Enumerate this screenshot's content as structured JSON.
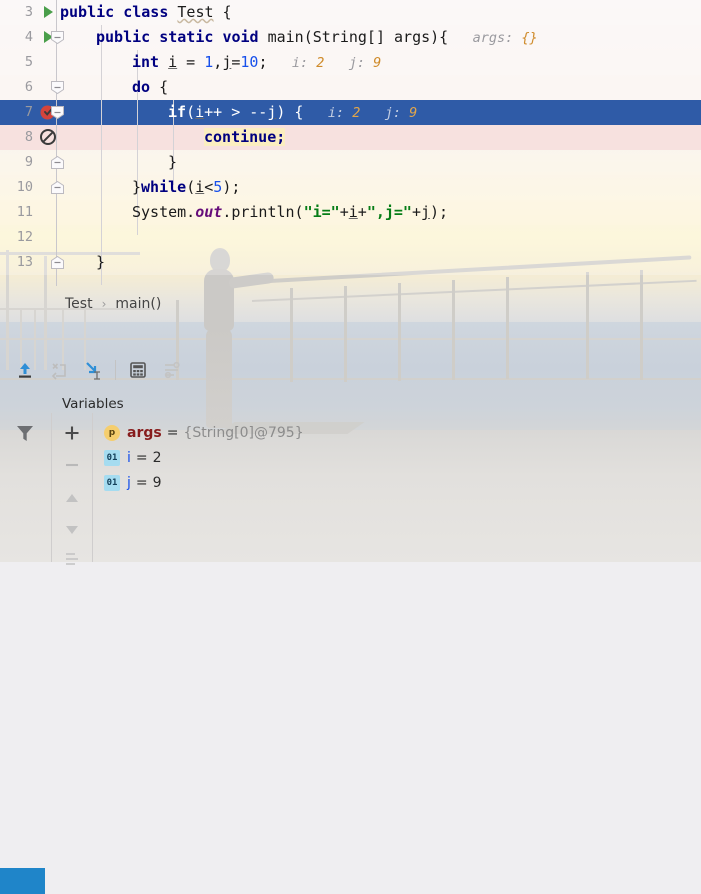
{
  "editor": {
    "lines": [
      {
        "num": "3",
        "indent": 0,
        "gutter_icon": "run-gutter-icon",
        "fold": null,
        "tokens": [
          {
            "t": "public",
            "c": "kw"
          },
          {
            "t": " ",
            "c": ""
          },
          {
            "t": "class",
            "c": "kw"
          },
          {
            "t": " ",
            "c": ""
          },
          {
            "t": "Test",
            "c": "warn"
          },
          {
            "t": " {",
            "c": ""
          }
        ]
      },
      {
        "num": "4",
        "indent": 1,
        "gutter_icon": "run-gutter-icon",
        "fold": "collapse",
        "tokens": [
          {
            "t": "public",
            "c": "kw"
          },
          {
            "t": " ",
            "c": ""
          },
          {
            "t": "static",
            "c": "kw"
          },
          {
            "t": " ",
            "c": ""
          },
          {
            "t": "void",
            "c": "kw"
          },
          {
            "t": " main(String[] args){",
            "c": ""
          }
        ],
        "hint": "args:",
        "hint_value": "{}"
      },
      {
        "num": "5",
        "indent": 2,
        "gutter_icon": null,
        "fold": null,
        "tokens": [
          {
            "t": "int",
            "c": "kw"
          },
          {
            "t": " ",
            "c": ""
          },
          {
            "t": "i",
            "c": "var"
          },
          {
            "t": " = ",
            "c": ""
          },
          {
            "t": "1",
            "c": "num"
          },
          {
            "t": ",",
            "c": ""
          },
          {
            "t": "j",
            "c": "var"
          },
          {
            "t": "=",
            "c": ""
          },
          {
            "t": "10",
            "c": "num"
          },
          {
            "t": ";",
            "c": ""
          }
        ],
        "hint": "i:",
        "hint_value": "2",
        "hint2": "j:",
        "hint2_value": "9"
      },
      {
        "num": "6",
        "indent": 2,
        "gutter_icon": null,
        "fold": "collapse",
        "tokens": [
          {
            "t": "do",
            "c": "kw"
          },
          {
            "t": " {",
            "c": ""
          }
        ]
      },
      {
        "num": "7",
        "indent": 3,
        "gutter_icon": "breakpoint-verified-icon",
        "fold": "collapse",
        "selected": true,
        "tokens": [
          {
            "t": "if",
            "c": "kw"
          },
          {
            "t": "(",
            "c": ""
          },
          {
            "t": "i",
            "c": "var"
          },
          {
            "t": "++ > --",
            "c": ""
          },
          {
            "t": "j",
            "c": "var"
          },
          {
            "t": ") {",
            "c": ""
          }
        ],
        "hint": "i:",
        "hint_value": "2",
        "hint2": "j:",
        "hint2_value": "9"
      },
      {
        "num": "8",
        "indent": 4,
        "gutter_icon": "breakpoint-muted-icon",
        "fold": null,
        "exec_line": true,
        "tokens": [
          {
            "t": "continue;",
            "c": "kw yellowhl"
          }
        ]
      },
      {
        "num": "9",
        "indent": 3,
        "gutter_icon": null,
        "fold": "expand",
        "tokens": [
          {
            "t": "}",
            "c": ""
          }
        ]
      },
      {
        "num": "10",
        "indent": 2,
        "gutter_icon": null,
        "fold": "expand",
        "tokens": [
          {
            "t": "}",
            "c": ""
          },
          {
            "t": "while",
            "c": "kw"
          },
          {
            "t": "(",
            "c": ""
          },
          {
            "t": "i",
            "c": "var"
          },
          {
            "t": "<",
            "c": ""
          },
          {
            "t": "5",
            "c": "num"
          },
          {
            "t": ");",
            "c": ""
          }
        ]
      },
      {
        "num": "11",
        "indent": 2,
        "gutter_icon": null,
        "fold": null,
        "tokens": [
          {
            "t": "System.",
            "c": ""
          },
          {
            "t": "out",
            "c": "fld"
          },
          {
            "t": ".println(",
            "c": ""
          },
          {
            "t": "\"i=\"",
            "c": "str"
          },
          {
            "t": "+",
            "c": ""
          },
          {
            "t": "i",
            "c": "var"
          },
          {
            "t": "+",
            "c": ""
          },
          {
            "t": "\",j=\"",
            "c": "str"
          },
          {
            "t": "+",
            "c": ""
          },
          {
            "t": "j",
            "c": "var"
          },
          {
            "t": ");",
            "c": ""
          }
        ]
      },
      {
        "num": "12",
        "indent": 0,
        "gutter_icon": null,
        "fold": null,
        "tokens": []
      },
      {
        "num": "13",
        "indent": 1,
        "gutter_icon": null,
        "fold": "expand",
        "tokens": [
          {
            "t": "}",
            "c": ""
          }
        ]
      }
    ],
    "colors": {
      "selected_line_bg": "#2f5ba7",
      "execution_line_bg": "#f7e1df",
      "keyword": "#000080",
      "string": "#067d17",
      "number": "#1750eb",
      "field": "#660e7a",
      "inline_hint": "#9a9a9f",
      "inline_hint_value": "#cf8b2b",
      "breakpoint": "#d4443c",
      "accent_blue": "#1f85c9"
    }
  },
  "breadcrumb": {
    "items": [
      "Test",
      "main()"
    ],
    "separator": "›"
  },
  "debug_toolbar": {
    "buttons": [
      {
        "name": "step-out-button",
        "label": "Step Out",
        "enabled": true
      },
      {
        "name": "force-step-into-button",
        "label": "Force Step Into",
        "enabled": false
      },
      {
        "name": "run-to-cursor-button",
        "label": "Run to Cursor",
        "enabled": true
      },
      {
        "name": "evaluate-expression-button",
        "label": "Evaluate Expression",
        "enabled": true
      },
      {
        "name": "settings-button",
        "label": "Settings",
        "enabled": false
      }
    ]
  },
  "variables_panel": {
    "title": "Variables",
    "toolbar": [
      {
        "name": "filter-icon",
        "label": "Filter"
      },
      {
        "name": "add-watch-button",
        "label": "+"
      },
      {
        "name": "remove-watch-button",
        "label": "−"
      },
      {
        "name": "move-up-button",
        "label": "▲"
      },
      {
        "name": "move-down-button",
        "label": "▼"
      }
    ],
    "rows": [
      {
        "icon": "p",
        "icon_kind": "parameter",
        "name": "args",
        "eq": "=",
        "value": "{String[0]@795}",
        "value_dim": true
      },
      {
        "icon": "01",
        "icon_kind": "primitive",
        "name": "i",
        "eq": "=",
        "value": "2",
        "value_dim": false
      },
      {
        "icon": "01",
        "icon_kind": "primitive",
        "name": "j",
        "eq": "=",
        "value": "9",
        "value_dim": false
      }
    ]
  }
}
